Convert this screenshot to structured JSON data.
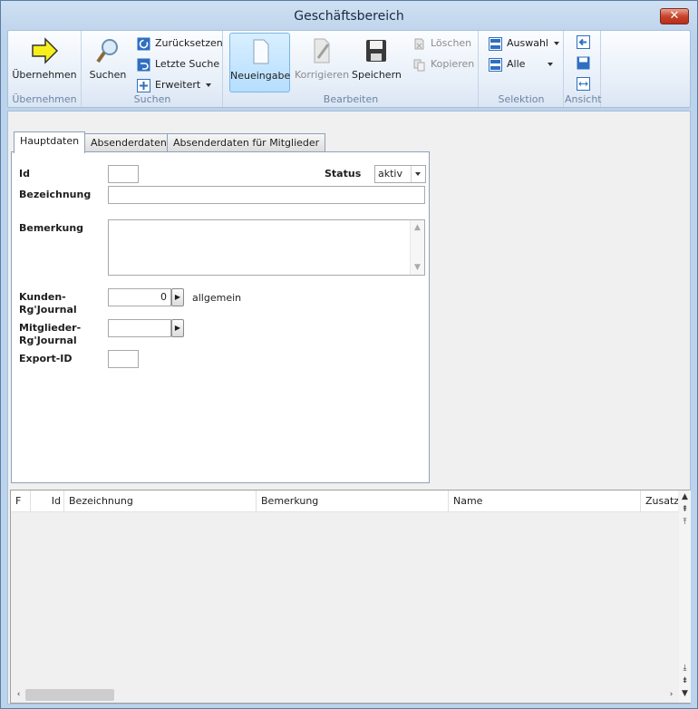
{
  "window": {
    "title": "Geschäftsbereich",
    "close_glyph": "✕"
  },
  "ribbon": {
    "groups": {
      "uebernehmen": "Übernehmen",
      "suchen": "Suchen",
      "bearbeiten": "Bearbeiten",
      "selektion": "Selektion",
      "ansicht": "Ansicht"
    },
    "uebernehmen_label": "Übernehmen",
    "suchen_label": "Suchen",
    "zuruecksetzen_label": "Zurücksetzen",
    "letzte_suche_label": "Letzte Suche",
    "erweitert_label": "Erweitert",
    "neueingabe_label": "Neueingabe",
    "korrigieren_label": "Korrigieren",
    "speichern_label": "Speichern",
    "loeschen_label": "Löschen",
    "kopieren_label": "Kopieren",
    "auswahl_label": "Auswahl",
    "alle_label": "Alle"
  },
  "tabs": [
    "Hauptdaten",
    "Absenderdaten",
    "Absenderdaten für Mitglieder"
  ],
  "form": {
    "id_label": "Id",
    "id_value": "",
    "status_label": "Status",
    "status_value": "aktiv",
    "bezeichnung_label": "Bezeichnung",
    "bezeichnung_value": "",
    "bemerkung_label": "Bemerkung",
    "bemerkung_value": "",
    "kunden_label_1": "Kunden-",
    "kunden_label_2": "Rg'Journal",
    "kunden_value": "0",
    "kunden_note": "allgemein",
    "mitglieder_label_1": "Mitglieder-",
    "mitglieder_label_2": "Rg'Journal",
    "mitglieder_value": "",
    "export_label": "Export-ID",
    "export_value": ""
  },
  "grid": {
    "columns": [
      "F",
      "Id",
      "Bezeichnung",
      "Bemerkung",
      "Name",
      "Zusatz"
    ]
  },
  "colors": {
    "accent": "#b6deff",
    "close": "#c7432c"
  }
}
